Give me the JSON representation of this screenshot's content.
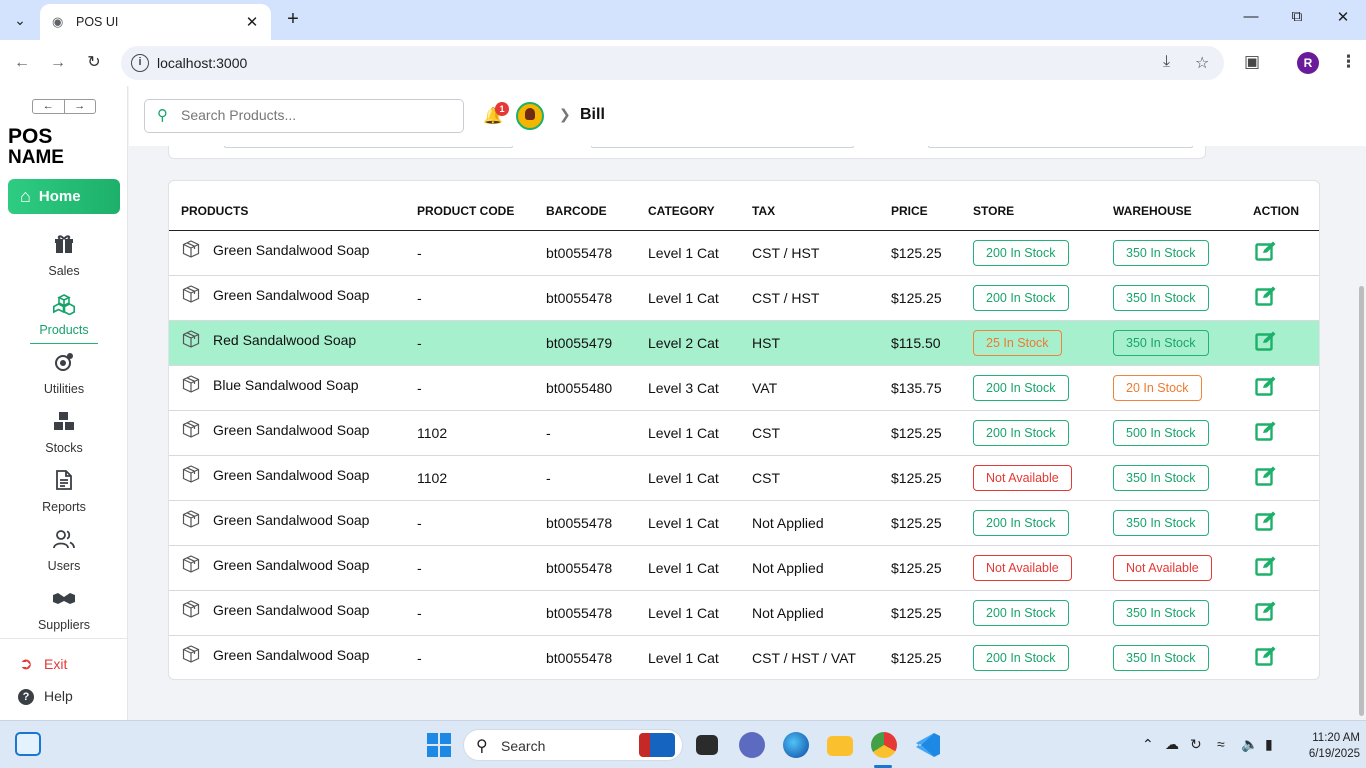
{
  "browser": {
    "tab_title": "POS UI",
    "url": "localhost:3000",
    "profile_initial": "R"
  },
  "sidebar": {
    "logo_line1": "POS",
    "logo_line2": "NAME",
    "home_label": "Home",
    "items": [
      {
        "label": "Sales",
        "icon": "gift-icon"
      },
      {
        "label": "Products",
        "icon": "boxes-icon"
      },
      {
        "label": "Utilities",
        "icon": "utilities-icon"
      },
      {
        "label": "Stocks",
        "icon": "stock-boxes-icon"
      },
      {
        "label": "Reports",
        "icon": "report-icon"
      },
      {
        "label": "Users",
        "icon": "users-icon"
      },
      {
        "label": "Suppliers",
        "icon": "handshake-icon"
      }
    ],
    "exit_label": "Exit",
    "help_label": "Help"
  },
  "header": {
    "search_placeholder": "Search Products...",
    "notification_count": "1",
    "breadcrumb": "Bill"
  },
  "table": {
    "columns": [
      "PRODUCTS",
      "PRODUCT CODE",
      "BARCODE",
      "CATEGORY",
      "TAX",
      "PRICE",
      "STORE",
      "WAREHOUSE",
      "ACTION"
    ],
    "rows": [
      {
        "product": "Green Sandalwood Soap",
        "code": "-",
        "barcode": "bt0055478",
        "category": "Level 1 Cat",
        "tax": "CST / HST",
        "price": "$125.25",
        "store": "200 In Stock",
        "warehouse": "350 In Stock"
      },
      {
        "product": "Green Sandalwood Soap",
        "code": "-",
        "barcode": "bt0055478",
        "category": "Level 1 Cat",
        "tax": "CST / HST",
        "price": "$125.25",
        "store": "200 In Stock",
        "warehouse": "350 In Stock"
      },
      {
        "product": "Red Sandalwood Soap",
        "code": "-",
        "barcode": "bt0055479",
        "category": "Level 2 Cat",
        "tax": "HST",
        "price": "$115.50",
        "store": "25 In Stock",
        "warehouse": "350 In Stock"
      },
      {
        "product": "Blue Sandalwood Soap",
        "code": "-",
        "barcode": "bt0055480",
        "category": "Level 3 Cat",
        "tax": "VAT",
        "price": "$135.75",
        "store": "200 In Stock",
        "warehouse": "20 In Stock"
      },
      {
        "product": "Green Sandalwood Soap",
        "code": "1102",
        "barcode": "-",
        "category": "Level 1 Cat",
        "tax": "CST",
        "price": "$125.25",
        "store": "200 In Stock",
        "warehouse": "500 In Stock"
      },
      {
        "product": "Green Sandalwood Soap",
        "code": "1102",
        "barcode": "-",
        "category": "Level 1 Cat",
        "tax": "CST",
        "price": "$125.25",
        "store": "Not Available",
        "warehouse": "350 In Stock"
      },
      {
        "product": "Green Sandalwood Soap",
        "code": "-",
        "barcode": "bt0055478",
        "category": "Level 1 Cat",
        "tax": "Not Applied",
        "price": "$125.25",
        "store": "200 In Stock",
        "warehouse": "350 In Stock"
      },
      {
        "product": "Green Sandalwood Soap",
        "code": "-",
        "barcode": "bt0055478",
        "category": "Level 1 Cat",
        "tax": "Not Applied",
        "price": "$125.25",
        "store": "Not Available",
        "warehouse": "Not Available"
      },
      {
        "product": "Green Sandalwood Soap",
        "code": "-",
        "barcode": "bt0055478",
        "category": "Level 1 Cat",
        "tax": "Not Applied",
        "price": "$125.25",
        "store": "200 In Stock",
        "warehouse": "350 In Stock"
      },
      {
        "product": "Green Sandalwood Soap",
        "code": "-",
        "barcode": "bt0055478",
        "category": "Level 1 Cat",
        "tax": "CST / HST / VAT",
        "price": "$125.25",
        "store": "200 In Stock",
        "warehouse": "350 In Stock"
      }
    ]
  },
  "colors": {
    "accent_green": "#1db06a",
    "selected_row": "#a7f0cd",
    "low_stock": "#ee7a2f",
    "unavailable": "#e53935"
  },
  "taskbar": {
    "search_label": "Search",
    "time": "11:20 AM",
    "date": "6/19/2025"
  }
}
